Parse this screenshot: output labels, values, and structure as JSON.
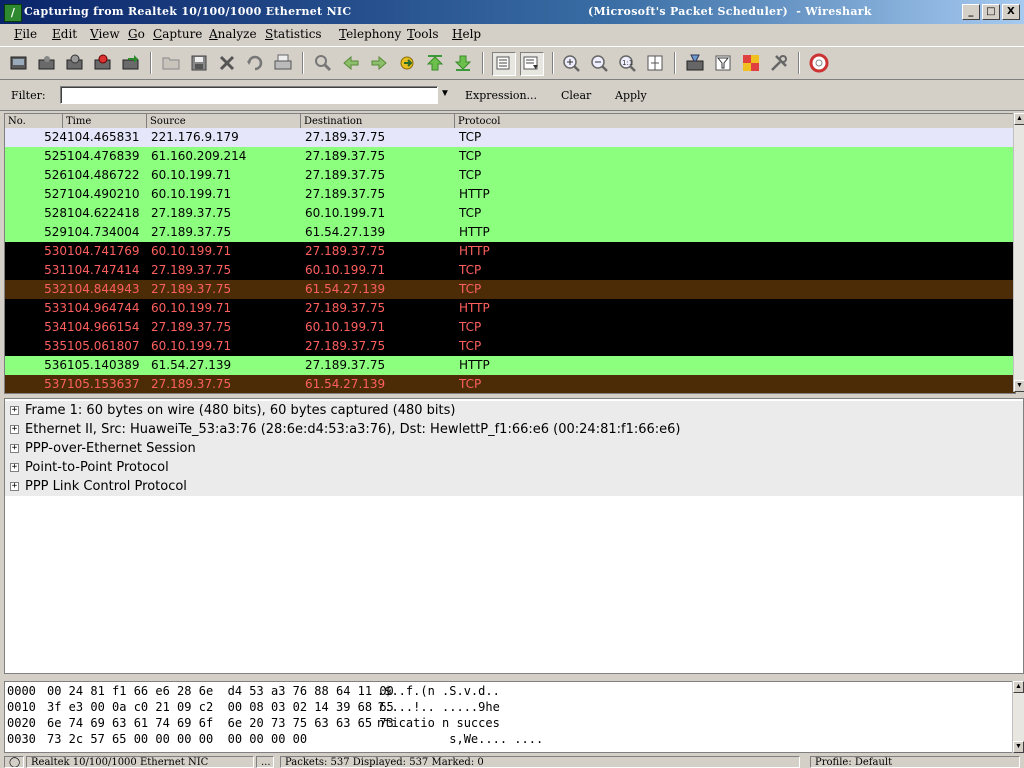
{
  "window": {
    "title_left": "Capturing from Realtek 10/100/1000 Ethernet NIC",
    "title_right": "(Microsoft's Packet Scheduler)  - Wireshark",
    "minimize": "_",
    "maximize": "□",
    "close": "X"
  },
  "menu": [
    "File",
    "Edit",
    "View",
    "Go",
    "Capture",
    "Analyze",
    "Statistics",
    "Telephony",
    "Tools",
    "Help"
  ],
  "filter": {
    "label": "Filter:",
    "value": "",
    "dropdown": "▼",
    "expression": "Expression...",
    "clear": "Clear",
    "apply": "Apply"
  },
  "columns": {
    "no": "No.",
    "time": "Time",
    "source": "Source",
    "destination": "Destination",
    "protocol": "Protocol"
  },
  "colors": {
    "tcp_green": "#8cff7f",
    "black_row": "#000000",
    "brown_row": "#4b2c06",
    "red_text": "#ff5f5f",
    "selected_blue": "#e6e6fa"
  },
  "packets": [
    {
      "no": "524",
      "time": "104.465831",
      "src": "221.176.9.179",
      "dst": "27.189.37.75",
      "proto": "TCP",
      "style": "lav"
    },
    {
      "no": "525",
      "time": "104.476839",
      "src": "61.160.209.214",
      "dst": "27.189.37.75",
      "proto": "TCP",
      "style": "green"
    },
    {
      "no": "526",
      "time": "104.486722",
      "src": "60.10.199.71",
      "dst": "27.189.37.75",
      "proto": "TCP",
      "style": "green"
    },
    {
      "no": "527",
      "time": "104.490210",
      "src": "60.10.199.71",
      "dst": "27.189.37.75",
      "proto": "HTTP",
      "style": "green"
    },
    {
      "no": "528",
      "time": "104.622418",
      "src": "27.189.37.75",
      "dst": "60.10.199.71",
      "proto": "TCP",
      "style": "green"
    },
    {
      "no": "529",
      "time": "104.734004",
      "src": "27.189.37.75",
      "dst": "61.54.27.139",
      "proto": "HTTP",
      "style": "green"
    },
    {
      "no": "530",
      "time": "104.741769",
      "src": "60.10.199.71",
      "dst": "27.189.37.75",
      "proto": "HTTP",
      "style": "black"
    },
    {
      "no": "531",
      "time": "104.747414",
      "src": "27.189.37.75",
      "dst": "60.10.199.71",
      "proto": "TCP",
      "style": "black"
    },
    {
      "no": "532",
      "time": "104.844943",
      "src": "27.189.37.75",
      "dst": "61.54.27.139",
      "proto": "TCP",
      "style": "brown"
    },
    {
      "no": "533",
      "time": "104.964744",
      "src": "60.10.199.71",
      "dst": "27.189.37.75",
      "proto": "HTTP",
      "style": "black"
    },
    {
      "no": "534",
      "time": "104.966154",
      "src": "27.189.37.75",
      "dst": "60.10.199.71",
      "proto": "TCP",
      "style": "black"
    },
    {
      "no": "535",
      "time": "105.061807",
      "src": "60.10.199.71",
      "dst": "27.189.37.75",
      "proto": "TCP",
      "style": "black"
    },
    {
      "no": "536",
      "time": "105.140389",
      "src": "61.54.27.139",
      "dst": "27.189.37.75",
      "proto": "HTTP",
      "style": "green"
    },
    {
      "no": "537",
      "time": "105.153637",
      "src": "27.189.37.75",
      "dst": "61.54.27.139",
      "proto": "TCP",
      "style": "brown"
    }
  ],
  "details": [
    "Frame 1: 60 bytes on wire (480 bits), 60 bytes captured (480 bits)",
    "Ethernet II, Src: HuaweiTe_53:a3:76 (28:6e:d4:53:a3:76), Dst: HewlettP_f1:66:e6 (00:24:81:f1:66:e6)",
    "PPP-over-Ethernet Session",
    "Point-to-Point Protocol",
    "PPP Link Control Protocol"
  ],
  "hex": [
    {
      "offset": "0000",
      "bytes": "00 24 81 f1 66 e6 28 6e  d4 53 a3 76 88 64 11 00",
      "ascii": ".$..f.(n .S.v.d.."
    },
    {
      "offset": "0010",
      "bytes": "3f e3 00 0a c0 21 09 c2  00 08 03 02 14 39 68 65",
      "ascii": "?....!.. .....9he"
    },
    {
      "offset": "0020",
      "bytes": "6e 74 69 63 61 74 69 6f  6e 20 73 75 63 63 65 73",
      "ascii": "nticatio n succes"
    },
    {
      "offset": "0030",
      "bytes": "73 2c 57 65 00 00 00 00  00 00 00 00",
      "ascii": "          s,We.... ...."
    }
  ],
  "status": {
    "interface": "Realtek 10/100/1000 Ethernet NIC",
    "dots": "...",
    "packets": "Packets: 537 Displayed: 537 Marked: 0",
    "profile": "Profile: Default"
  }
}
